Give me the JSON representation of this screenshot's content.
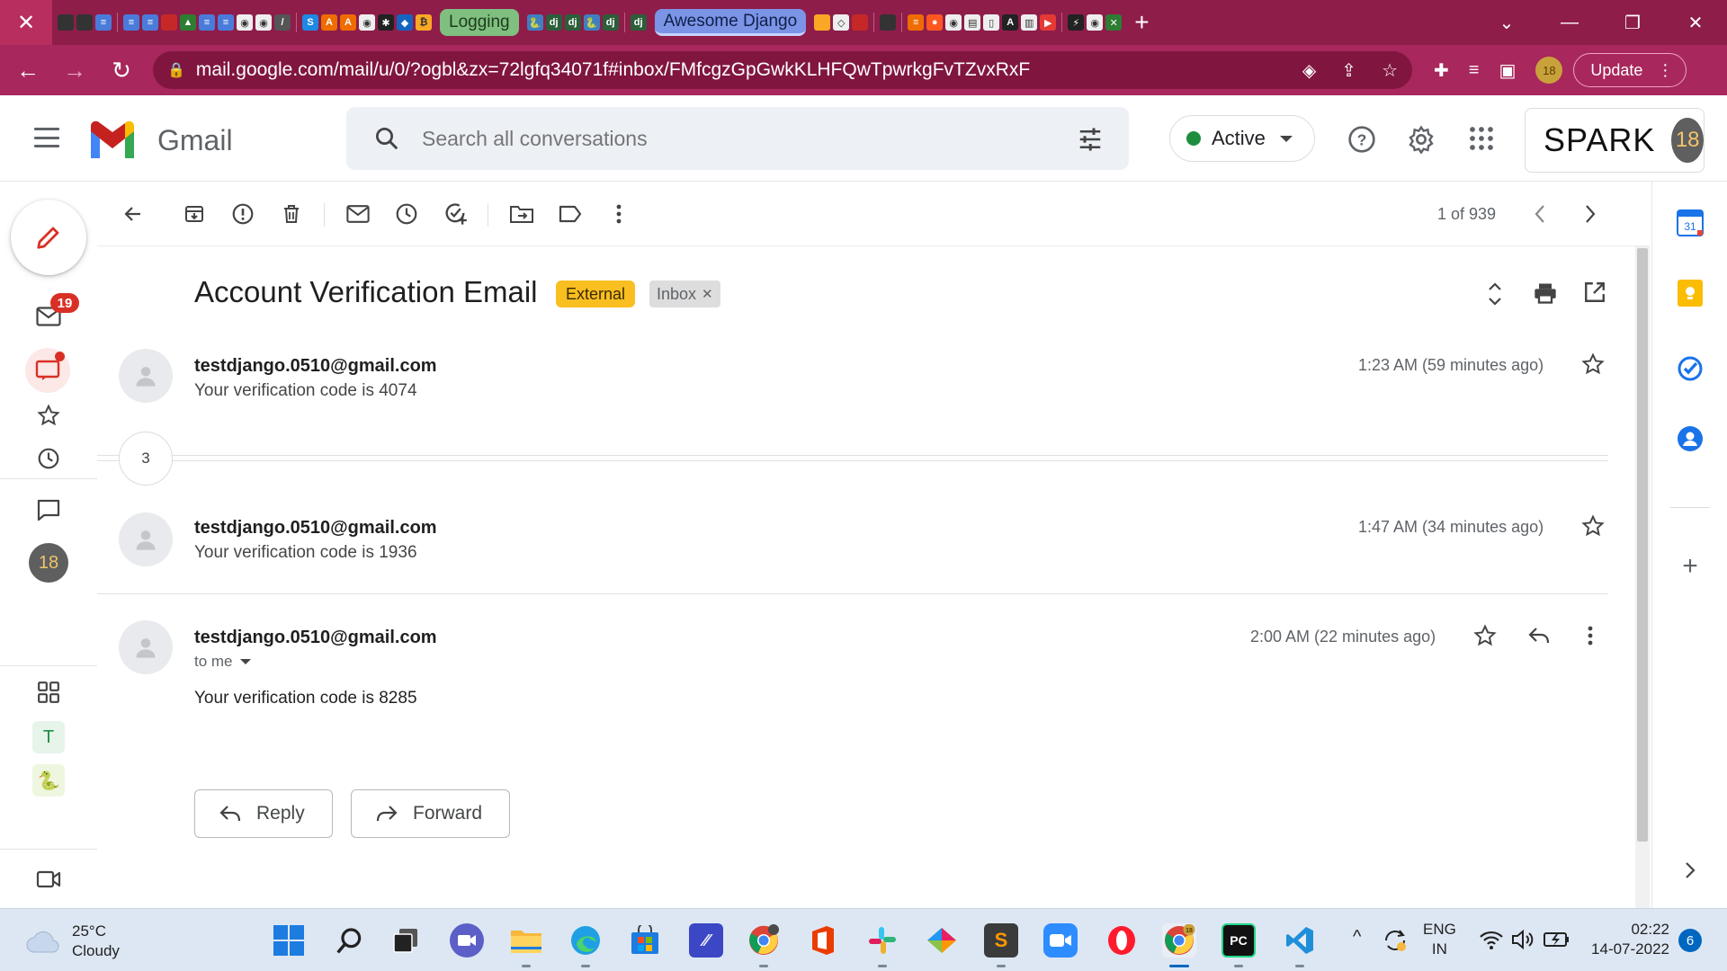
{
  "browser": {
    "pinned_tabs": [
      {
        "label": "Logging"
      },
      {
        "label": "Awesome Django"
      }
    ],
    "dj_labels": [
      "dj",
      "dj",
      "dj",
      "dj"
    ],
    "url": "mail.google.com/mail/u/0/?ogbl&zx=72lgfq34071f#inbox/FMfcgzGpGwkKLHFQwTpwrkgFvTZvxRxF",
    "profile_badge": "18",
    "update_label": "Update"
  },
  "gmail": {
    "logo_text": "Gmail",
    "search_placeholder": "Search all conversations",
    "status_label": "Active",
    "spark_word": "SPARK",
    "spark_avatar": "18",
    "rail_badge": "19",
    "rail_avatar": "18",
    "rail_app_t": "T"
  },
  "toolbar": {
    "pager": "1 of 939"
  },
  "conversation": {
    "subject": "Account Verification Email",
    "labels": {
      "external": "External",
      "inbox": "Inbox"
    },
    "collapsed_count": "3",
    "messages": [
      {
        "sender": "testdjango.0510@gmail.com",
        "snippet": "Your verification code is 4074",
        "time": "1:23 AM (59 minutes ago)"
      },
      {
        "sender": "testdjango.0510@gmail.com",
        "snippet": "Your verification code is 1936",
        "time": "1:47 AM (34 minutes ago)"
      },
      {
        "sender": "testdjango.0510@gmail.com",
        "recipient": "to me",
        "body": "Your verification code is 8285",
        "time": "2:00 AM (22 minutes ago)"
      }
    ],
    "reply_label": "Reply",
    "forward_label": "Forward"
  },
  "side_panel": {
    "calendar_day": "31"
  },
  "taskbar": {
    "weather_temp": "25°C",
    "weather_desc": "Cloudy",
    "lang_1": "ENG",
    "lang_2": "IN",
    "time": "02:22",
    "date": "14-07-2022",
    "notification_count": "6",
    "chrome_badge": "18",
    "pycharm_label": "PC"
  },
  "colors": {
    "tabbar": "#8e1d4a",
    "addressbar": "#a8275c",
    "external_label": "#f9bf21",
    "active_dot": "#1e8e3e",
    "badge_red": "#d93025"
  }
}
